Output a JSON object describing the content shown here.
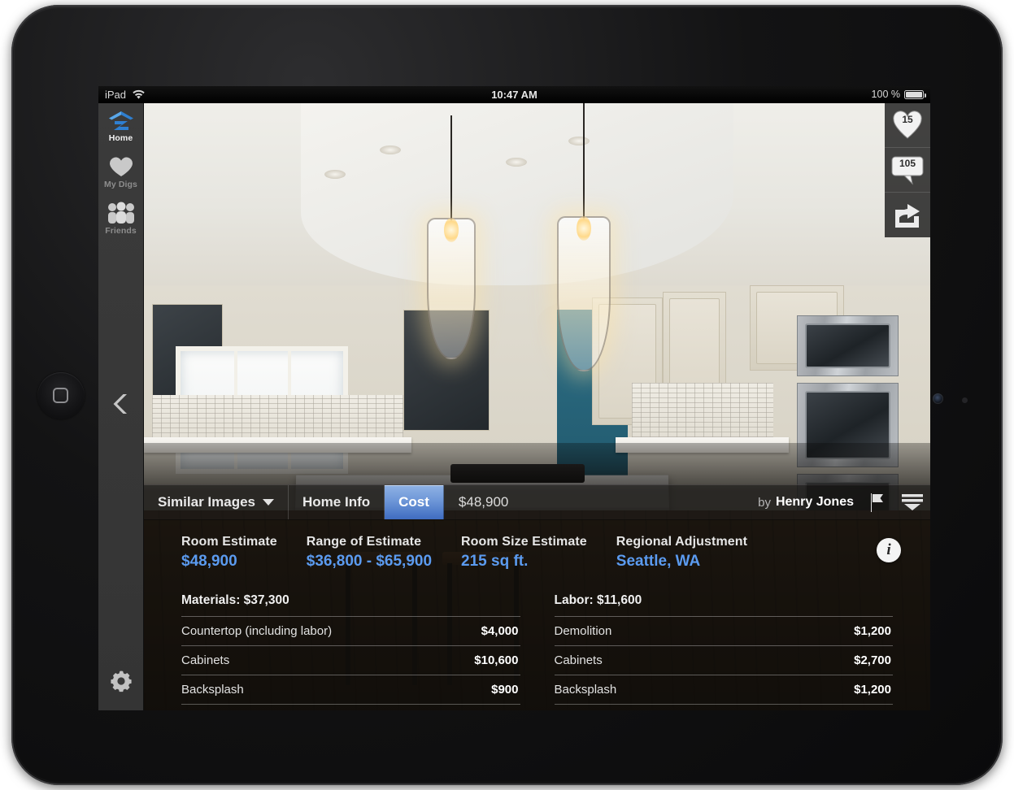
{
  "status_bar": {
    "carrier": "iPad",
    "wifi_icon": "wifi-icon",
    "time": "10:47 AM",
    "battery_percent": "100 %",
    "battery_icon": "battery-full-icon"
  },
  "sidebar": {
    "items": [
      {
        "label": "Home",
        "icon": "zillow-home-logo-icon",
        "active": true
      },
      {
        "label": "My Digs",
        "icon": "heart-icon",
        "active": false
      },
      {
        "label": "Friends",
        "icon": "people-group-icon",
        "active": false
      }
    ],
    "back_icon": "chevron-left-icon",
    "settings_icon": "gear-icon"
  },
  "social_rail": {
    "likes": "15",
    "likes_icon": "heart-icon",
    "comments": "105",
    "comments_icon": "comment-bubble-icon",
    "share_icon": "share-arrow-icon"
  },
  "action_bar": {
    "similar_images": "Similar Images",
    "similar_images_caret": "chevron-down-icon",
    "home_info": "Home Info",
    "cost": "Cost",
    "price": "$48,900",
    "by_prefix": "by",
    "author": "Henry Jones",
    "flag_icon": "flag-icon",
    "collapse_icon": "collapse-panel-icon"
  },
  "cost_panel": {
    "info_icon": "info-icon",
    "summary": [
      {
        "label": "Room Estimate",
        "value": "$48,900"
      },
      {
        "label": "Range of Estimate",
        "value": "$36,800 - $65,900"
      },
      {
        "label": "Room Size Estimate",
        "value": "215 sq ft."
      },
      {
        "label": "Regional Adjustment",
        "value": "Seattle, WA"
      }
    ],
    "materials": {
      "heading": "Materials: $37,300",
      "rows": [
        {
          "item": "Countertop (including labor)",
          "amount": "$4,000"
        },
        {
          "item": "Cabinets",
          "amount": "$10,600"
        },
        {
          "item": "Backsplash",
          "amount": "$900"
        }
      ]
    },
    "labor": {
      "heading": "Labor: $11,600",
      "rows": [
        {
          "item": "Demolition",
          "amount": "$1,200"
        },
        {
          "item": "Cabinets",
          "amount": "$2,700"
        },
        {
          "item": "Backsplash",
          "amount": "$1,200"
        }
      ]
    }
  },
  "photo": {
    "alt": "remodeled white kitchen with island, pendant lights and stainless ovens"
  },
  "colors": {
    "accent_blue": "#5b9bf0",
    "cost_button_blue": "#3f6cc0",
    "sidebar_gray": "#3b3b3b",
    "panel_overlay": "rgba(20,17,14,.52)"
  }
}
